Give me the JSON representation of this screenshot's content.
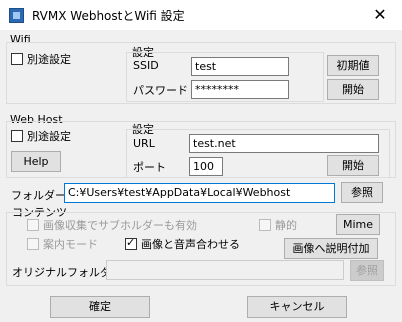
{
  "window": {
    "title": "RVMX WebhostとWifi 設定",
    "close": "✕"
  },
  "wifi": {
    "group": "Wifi",
    "separate": "別途設定",
    "settings": "設定",
    "ssid_label": "SSID",
    "ssid": "test",
    "password_label": "パスワード",
    "password": "********",
    "default_btn": "初期値",
    "start_btn": "開始"
  },
  "webhost": {
    "group": "Web Host",
    "separate": "別途設定",
    "help": "Help",
    "settings": "設定",
    "url_label": "URL",
    "url": "test.net",
    "port_label": "ポート",
    "port": "100",
    "start_btn": "開始"
  },
  "folder": {
    "label": "フォルダー",
    "path": "C:¥Users¥test¥AppData¥Local¥Webhost",
    "browse": "参照"
  },
  "contents": {
    "group": "コンテンツ",
    "subfolder": "画像収集でサブホルダーも有効",
    "quiet": "静的",
    "mime": "Mime",
    "guide_mode": "案内モード",
    "sync": "画像と音声合わせる",
    "add_desc": "画像へ説明付加",
    "orig_folder": "オリジナルフォルダー",
    "orig_browse": "参照"
  },
  "footer": {
    "ok": "確定",
    "cancel": "キャンセル"
  }
}
